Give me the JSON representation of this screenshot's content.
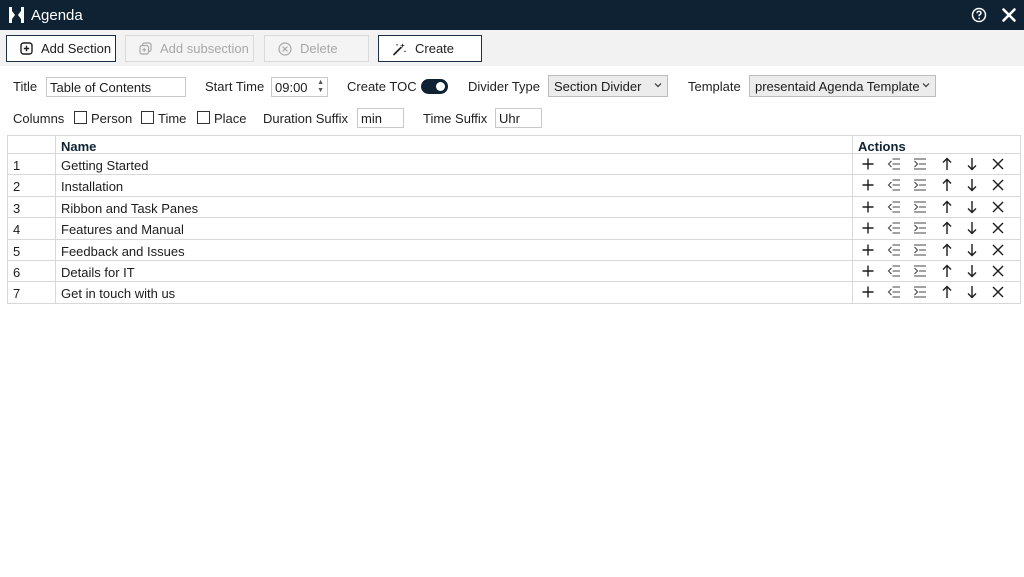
{
  "window": {
    "title": "Agenda",
    "help_icon": "help-circle-icon",
    "close_icon": "close-icon",
    "logo_icon": "app-logo-icon"
  },
  "toolbar": {
    "add_section": "Add Section",
    "add_subsection": "Add subsection",
    "delete": "Delete",
    "create": "Create"
  },
  "settings": {
    "title_label": "Title",
    "title_value": "Table of Contents",
    "start_time_label": "Start Time",
    "start_time_value": "09:00",
    "create_toc_label": "Create TOC",
    "create_toc_on": true,
    "divider_type_label": "Divider Type",
    "divider_type_value": "Section Divider",
    "template_label": "Template",
    "template_value": "presentaid Agenda Template",
    "columns_label": "Columns",
    "person_label": "Person",
    "time_label": "Time",
    "place_label": "Place",
    "duration_suffix_label": "Duration Suffix",
    "duration_suffix_value": "min",
    "time_suffix_label": "Time Suffix",
    "time_suffix_value": "Uhr"
  },
  "grid": {
    "headers": {
      "num": "",
      "name": "Name",
      "actions": "Actions"
    },
    "rows": [
      {
        "num": "1",
        "name": "Getting Started"
      },
      {
        "num": "2",
        "name": "Installation"
      },
      {
        "num": "3",
        "name": "Ribbon and Task Panes"
      },
      {
        "num": "4",
        "name": "Features and Manual"
      },
      {
        "num": "5",
        "name": "Feedback and Issues"
      },
      {
        "num": "6",
        "name": "Details for IT"
      },
      {
        "num": "7",
        "name": "Get in touch with us"
      }
    ],
    "action_icons": [
      "plus-icon",
      "outdent-icon",
      "indent-icon",
      "arrow-up-icon",
      "arrow-down-icon",
      "close-icon"
    ]
  },
  "colors": {
    "titlebar": "#0f2233",
    "toolbar": "#f2f2f2",
    "accent": "#0f2233"
  }
}
